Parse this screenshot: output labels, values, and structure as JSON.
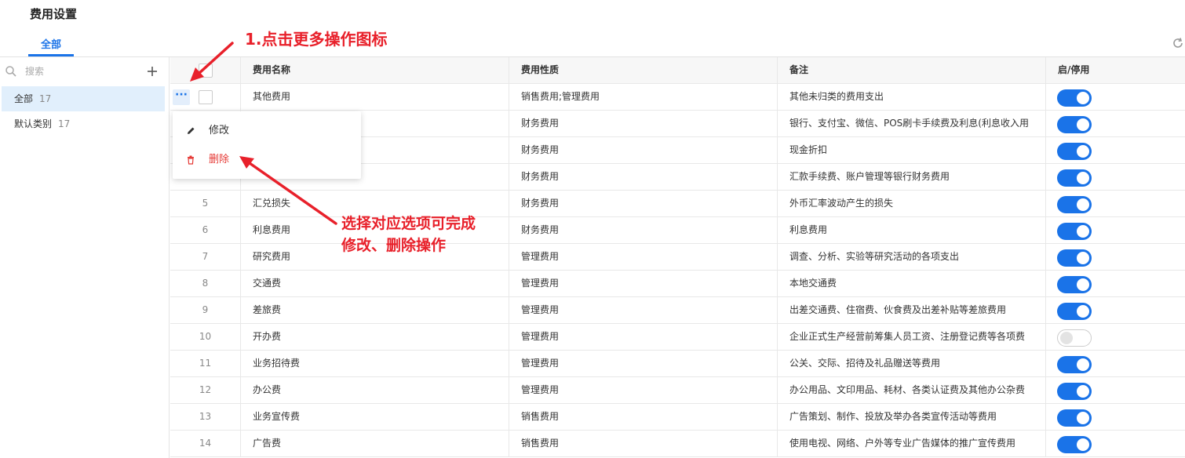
{
  "page": {
    "title": "费用设置"
  },
  "tabs": [
    {
      "label": "全部",
      "active": true
    }
  ],
  "sidebar": {
    "search_placeholder": "搜索",
    "categories": [
      {
        "label": "全部",
        "count": "17",
        "active": true
      },
      {
        "label": "默认类别",
        "count": "17",
        "active": false
      }
    ]
  },
  "table": {
    "headers": {
      "name": "费用名称",
      "nature": "费用性质",
      "note": "备注",
      "status": "启/停用"
    },
    "rows": [
      {
        "idx": "",
        "name": "其他费用",
        "nature": "销售费用;管理费用",
        "note": "其他未归类的费用支出",
        "enabled": true
      },
      {
        "idx": "",
        "name": "",
        "nature": "财务费用",
        "note": "银行、支付宝、微信、POS刷卡手续费及利息(利息收入用",
        "enabled": true
      },
      {
        "idx": "",
        "name": "",
        "nature": "财务费用",
        "note": "现金折扣",
        "enabled": true
      },
      {
        "idx": "",
        "name": "",
        "nature": "财务费用",
        "note": "汇款手续费、账户管理等银行财务费用",
        "enabled": true
      },
      {
        "idx": "5",
        "name": "汇兑损失",
        "nature": "财务费用",
        "note": "外币汇率波动产生的损失",
        "enabled": true
      },
      {
        "idx": "6",
        "name": "利息费用",
        "nature": "财务费用",
        "note": "利息费用",
        "enabled": true
      },
      {
        "idx": "7",
        "name": "研究费用",
        "nature": "管理费用",
        "note": "调查、分析、实验等研究活动的各项支出",
        "enabled": true
      },
      {
        "idx": "8",
        "name": "交通费",
        "nature": "管理费用",
        "note": "本地交通费",
        "enabled": true
      },
      {
        "idx": "9",
        "name": "差旅费",
        "nature": "管理费用",
        "note": "出差交通费、住宿费、伙食费及出差补贴等差旅费用",
        "enabled": true
      },
      {
        "idx": "10",
        "name": "开办费",
        "nature": "管理费用",
        "note": "企业正式生产经营前筹集人员工资、注册登记费等各项费",
        "enabled": false
      },
      {
        "idx": "11",
        "name": "业务招待费",
        "nature": "管理费用",
        "note": "公关、交际、招待及礼品赠送等费用",
        "enabled": true
      },
      {
        "idx": "12",
        "name": "办公费",
        "nature": "管理费用",
        "note": "办公用品、文印用品、耗材、各类认证费及其他办公杂费",
        "enabled": true
      },
      {
        "idx": "13",
        "name": "业务宣传费",
        "nature": "销售费用",
        "note": "广告策划、制作、投放及举办各类宣传活动等费用",
        "enabled": true
      },
      {
        "idx": "14",
        "name": "广告费",
        "nature": "销售费用",
        "note": "使用电视、网络、户外等专业广告媒体的推广宣传费用",
        "enabled": true
      }
    ]
  },
  "popup_menu": {
    "items": [
      {
        "label": "修改",
        "icon": "pencil-icon"
      },
      {
        "label": "删除",
        "icon": "trash-icon"
      }
    ]
  },
  "annotations": {
    "step1": "1.点击更多操作图标",
    "step2_line1": "选择对应选项可完成",
    "step2_line2": "修改、删除操作"
  },
  "colors": {
    "accent": "#1a73e8",
    "danger": "#e53935",
    "annotation": "#e8202a",
    "sidebar_active": "#e1effc"
  }
}
